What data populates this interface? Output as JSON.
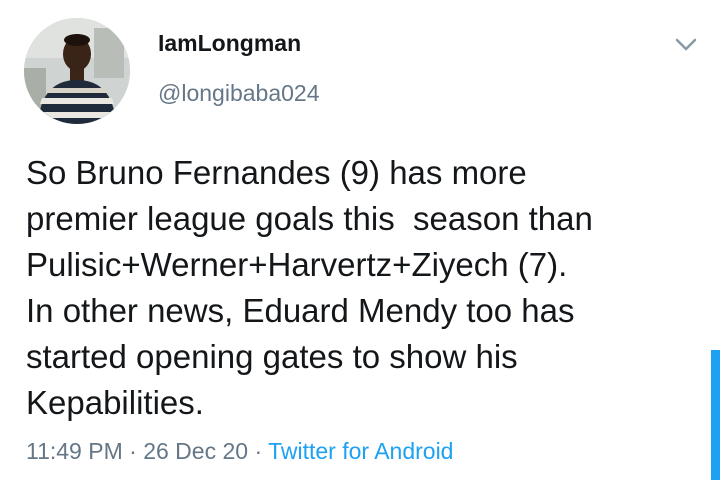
{
  "tweet": {
    "author": {
      "display_name": "IamLongman",
      "handle": "@longibaba024"
    },
    "text_lines": [
      "So Bruno Fernandes (9) has more",
      "premier league goals this  season than",
      "Pulisic+Werner+Harvertz+Ziyech (7).",
      "In other news, Eduard Mendy too has",
      "started opening gates to show his",
      "Kepabilities."
    ],
    "time": "11:49 PM",
    "date": "26 Dec 20",
    "separator": "·",
    "source": "Twitter for Android"
  },
  "icons": {
    "more": "chevron-down-icon"
  },
  "colors": {
    "text": "#14171a",
    "secondary_text": "#657786",
    "accent": "#1da1f2",
    "background": "#ffffff"
  }
}
